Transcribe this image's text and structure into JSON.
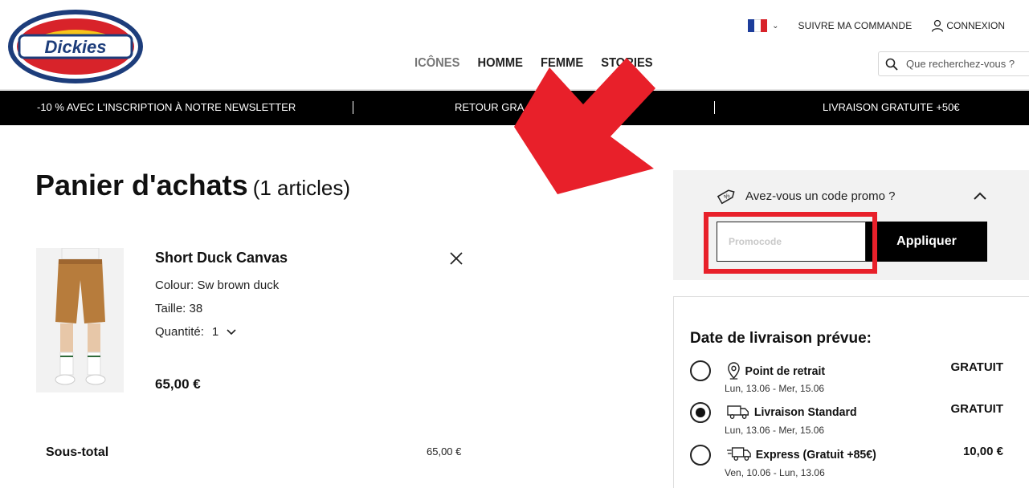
{
  "brand": {
    "logo_text": "Dickies",
    "colors": {
      "red": "#d8232a",
      "yellow": "#f7c51a",
      "navy": "#1d3d7b"
    }
  },
  "topbar": {
    "flag_icon": "france-flag-icon",
    "track_order": "SUIVRE MA COMMANDE",
    "login": "CONNEXION"
  },
  "nav": {
    "items": [
      "ICÔNES",
      "HOMME",
      "FEMME",
      "STORIES"
    ]
  },
  "search": {
    "placeholder": "Que recherchez-vous ?"
  },
  "banner": {
    "newsletter": "-10 % AVEC L'INSCRIPTION À NOTRE NEWSLETTER",
    "returns": "RETOUR GRA",
    "shipping": "LIVRAISON GRATUITE +50€"
  },
  "cart": {
    "title": "Panier d'achats",
    "count": "(1 articles)",
    "item": {
      "name": "Short Duck Canvas",
      "colour": "Colour: Sw brown duck",
      "size": "Taille: 38",
      "quantity_label": "Quantité:",
      "quantity": "1",
      "price": "65,00 €"
    },
    "subtotal_label": "Sous-total",
    "subtotal_value": "65,00 €"
  },
  "promo": {
    "question": "Avez-vous un code promo ?",
    "placeholder": "Promocode",
    "apply": "Appliquer",
    "highlight_color": "#e8202a"
  },
  "delivery": {
    "title": "Date de livraison prévue:",
    "options": [
      {
        "label": "Point de retrait",
        "dates": "Lun, 13.06 - Mer, 15.06",
        "cost": "GRATUIT",
        "icon": "map-pin-icon",
        "selected": false
      },
      {
        "label": "Livraison Standard",
        "dates": "Lun, 13.06 - Mer, 15.06",
        "cost": "GRATUIT",
        "icon": "truck-icon",
        "selected": true
      },
      {
        "label": "Express (Gratuit +85€)",
        "dates": "Ven, 10.06 - Lun, 13.06",
        "cost": "10,00 €",
        "icon": "fast-truck-icon",
        "selected": false
      }
    ]
  }
}
